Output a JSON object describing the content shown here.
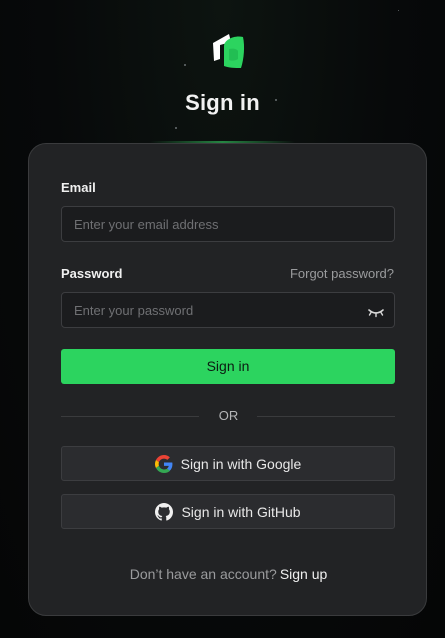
{
  "header": {
    "title": "Sign in"
  },
  "form": {
    "email_label": "Email",
    "email_placeholder": "Enter your email address",
    "password_label": "Password",
    "forgot_password": "Forgot password?",
    "password_placeholder": "Enter your password",
    "submit_label": "Sign in"
  },
  "divider": {
    "text": "OR"
  },
  "oauth": {
    "google_label": "Sign in with Google",
    "github_label": "Sign in with GitHub"
  },
  "footer": {
    "prompt": "Don’t have an account?",
    "signup_link": "Sign up"
  },
  "colors": {
    "accent": "#2cd45f",
    "card": "#222325",
    "background": "#07090a"
  },
  "icons": {
    "logo": "leaf-logo-icon",
    "password_toggle": "eye-closed-icon",
    "google": "google-icon",
    "github": "github-icon"
  }
}
